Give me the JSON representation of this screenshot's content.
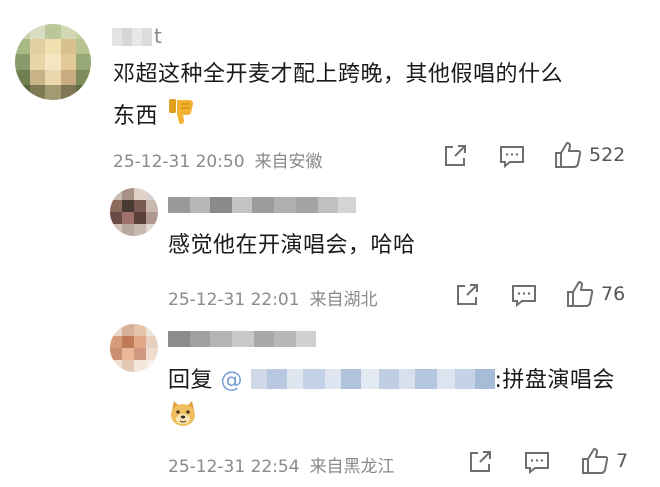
{
  "comments": [
    {
      "user_suffix": "t",
      "text_line1": "邓超这种全开麦才配上跨晚，其他假唱的什么",
      "text_line2": "东西",
      "emoji": "thumbs-down",
      "date": "25-12-31 20:50",
      "location": "来自安徽",
      "likes": "522"
    },
    {
      "text_line1": "感觉他在开演唱会，哈哈",
      "date": "25-12-31 22:01",
      "location": "来自湖北",
      "likes": "76"
    },
    {
      "reply_prefix": "回复",
      "reply_mention": "@",
      "reply_text": ":拼盘演唱会",
      "emoji": "doge",
      "date": "25-12-31 22:54",
      "location": "来自黑龙江",
      "likes": "7"
    }
  ],
  "colors": {
    "meta": "#8a8a8a",
    "icon": "#6f6f6f",
    "emoji_thumb": "#f2b232"
  }
}
